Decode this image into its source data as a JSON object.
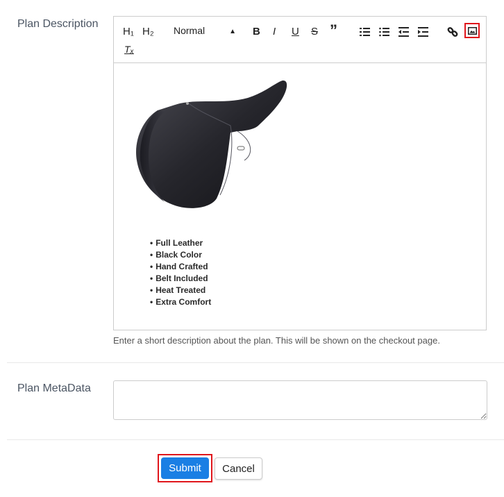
{
  "description_field": {
    "label": "Plan Description",
    "toolbar": {
      "h1": "H₁",
      "h2": "H₂",
      "format_select": "Normal",
      "bold": "B",
      "italic": "I",
      "underline": "U",
      "strike": "S",
      "blockquote": "”",
      "clean": "Tₓ"
    },
    "content": {
      "image_alt": "Black leather saddle",
      "features": [
        "Full Leather",
        "Black Color",
        "Hand Crafted",
        "Belt Included",
        "Heat Treated",
        "Extra Comfort"
      ]
    },
    "help_text": "Enter a short description about the plan. This will be shown on the checkout page."
  },
  "metadata_field": {
    "label": "Plan MetaData",
    "value": ""
  },
  "actions": {
    "submit": "Submit",
    "cancel": "Cancel"
  },
  "colors": {
    "primary": "#1a7fe4",
    "highlight": "#e0151b"
  }
}
